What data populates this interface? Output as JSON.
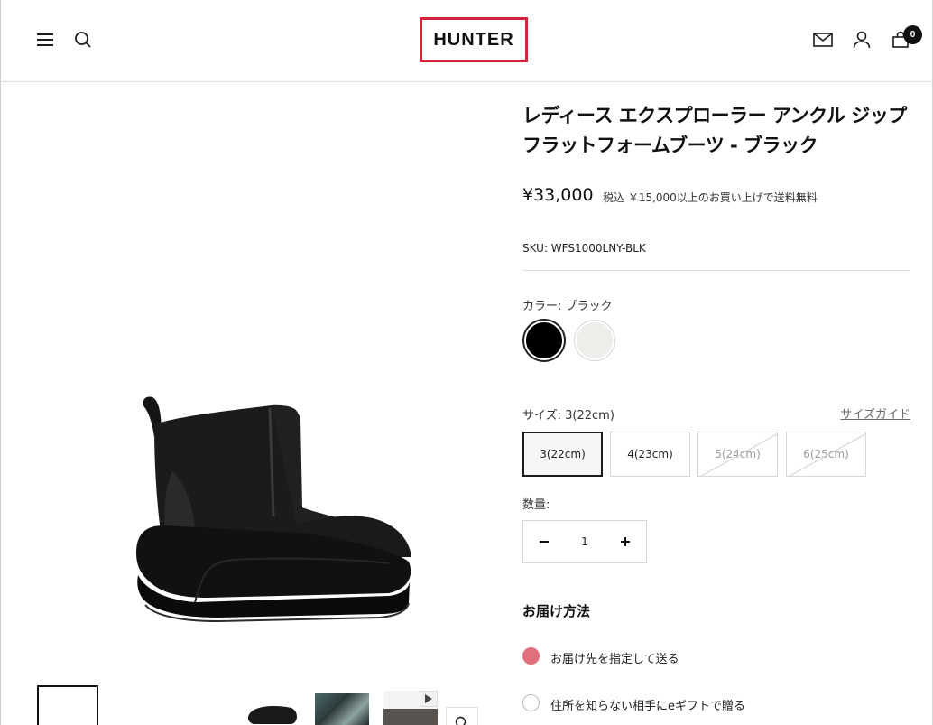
{
  "header": {
    "logo_text": "HUNTER",
    "cart_count": "0",
    "brand_color": "#d3223d"
  },
  "product": {
    "title": "レディース エクスプローラー アンクル ジップ フラットフォームブーツ - ブラック",
    "price": "¥33,000",
    "price_note": "税込 ￥15,000以上のお買い上げで送料無料",
    "sku": "SKU: WFS1000LNY-BLK",
    "color_label": "カラー: ブラック",
    "colors": [
      {
        "name": "ブラック",
        "hex": "#000000",
        "selected": true
      },
      {
        "name": "ホワイト",
        "hex": "#eceeea",
        "selected": false
      }
    ],
    "size_label": "サイズ:  3(22cm)",
    "size_guide": "サイズガイド",
    "sizes": [
      {
        "label": "3(22cm)",
        "state": "selected"
      },
      {
        "label": "4(23cm)",
        "state": "available"
      },
      {
        "label": "5(24cm)",
        "state": "soldout"
      },
      {
        "label": "6(25cm)",
        "state": "soldout"
      }
    ],
    "quantity_label": "数量:",
    "quantity": "1",
    "delivery_title": "お届け方法",
    "delivery_options": [
      {
        "label": "お届け先を指定して送る",
        "selected": true
      },
      {
        "label": "住所を知らない相手にeギフトで贈る",
        "selected": false
      }
    ],
    "accent_color": "#e16f7c"
  }
}
